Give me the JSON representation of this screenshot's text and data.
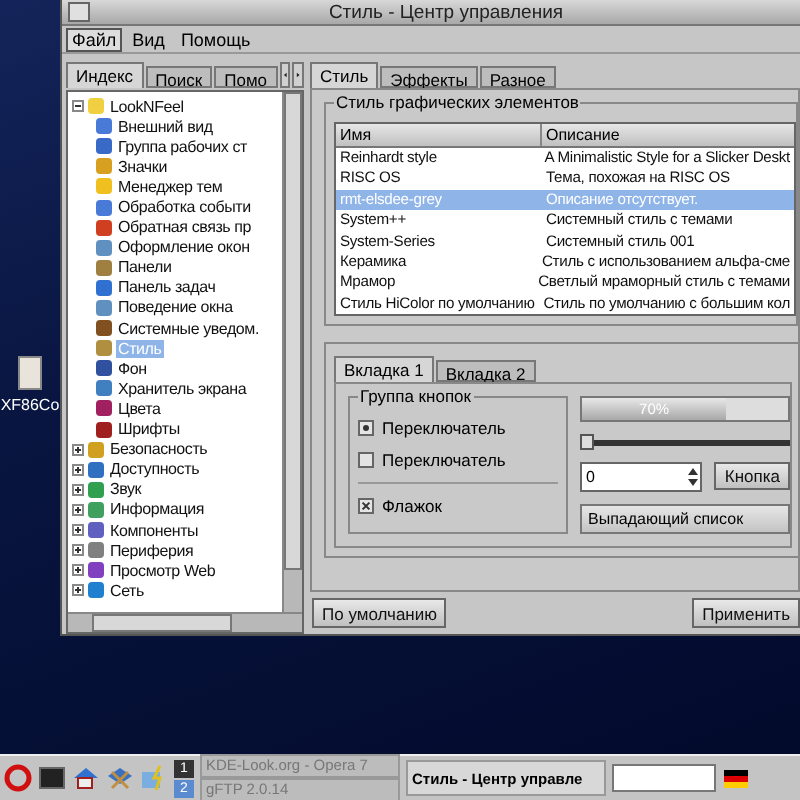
{
  "desktop_icon": {
    "label": "XF86Co"
  },
  "window": {
    "title": "Стиль - Центр управления"
  },
  "menu": [
    {
      "label": "Файл",
      "selected": true
    },
    {
      "label": "Вид",
      "selected": false
    },
    {
      "label": "Помощь",
      "selected": false
    }
  ],
  "left_tabs": [
    {
      "label": "Индекс",
      "selected": true
    },
    {
      "label": "Поиск",
      "selected": false
    },
    {
      "label": "Помо",
      "selected": false
    }
  ],
  "tree": [
    {
      "label": "LookNFeel",
      "expanded": true,
      "selected": false,
      "children": [
        {
          "label": "Внешний вид",
          "selected": false
        },
        {
          "label": "Группа рабочих ст",
          "selected": false
        },
        {
          "label": "Значки",
          "selected": false
        },
        {
          "label": "Менеджер тем",
          "selected": false
        },
        {
          "label": "Обработка событи",
          "selected": false
        },
        {
          "label": "Обратная связь пр",
          "selected": false
        },
        {
          "label": "Оформление окон",
          "selected": false
        },
        {
          "label": "Панели",
          "selected": false
        },
        {
          "label": "Панель задач",
          "selected": false
        },
        {
          "label": "Поведение окна",
          "selected": false
        },
        {
          "label": "Системные уведом.",
          "selected": false
        },
        {
          "label": "Стиль",
          "selected": true
        },
        {
          "label": "Фон",
          "selected": false
        },
        {
          "label": "Хранитель экрана",
          "selected": false
        },
        {
          "label": "Цвета",
          "selected": false
        },
        {
          "label": "Шрифты",
          "selected": false
        }
      ]
    },
    {
      "label": "Безопасность",
      "expanded": false,
      "selected": false
    },
    {
      "label": "Доступность",
      "expanded": false,
      "selected": false
    },
    {
      "label": "Звук",
      "expanded": false,
      "selected": false
    },
    {
      "label": "Информация",
      "expanded": false,
      "selected": false
    },
    {
      "label": "Компоненты",
      "expanded": false,
      "selected": false
    },
    {
      "label": "Периферия",
      "expanded": false,
      "selected": false
    },
    {
      "label": "Просмотр Web",
      "expanded": false,
      "selected": false
    },
    {
      "label": "Сеть",
      "expanded": false,
      "selected": false
    }
  ],
  "right_tabs": [
    {
      "label": "Стиль",
      "selected": true
    },
    {
      "label": "Эффекты",
      "selected": false
    },
    {
      "label": "Разное",
      "selected": false
    }
  ],
  "style_group": {
    "title": "Стиль графических элементов",
    "columns": [
      "Имя",
      "Описание"
    ],
    "rows": [
      {
        "name": "Reinhardt style",
        "description": "A Minimalistic Style for a Slicker Deskt",
        "selected": false
      },
      {
        "name": "RISC OS",
        "description": "Тема, похожая на RISC OS",
        "selected": false
      },
      {
        "name": "rmt-elsdee-grey",
        "description": "Описание отсутствует.",
        "selected": true
      },
      {
        "name": "System++",
        "description": "Системный стиль с темами",
        "selected": false
      },
      {
        "name": "System-Series",
        "description": "Системный стиль 001",
        "selected": false
      },
      {
        "name": "Керамика",
        "description": "Стиль с использованием альфа-сме",
        "selected": false
      },
      {
        "name": "Мрамор",
        "description": "Светлый мраморный стиль с темами",
        "selected": false
      },
      {
        "name": "Стиль HiColor по умолчанию",
        "description": "Стиль по умолчанию с большим кол",
        "selected": false
      }
    ]
  },
  "preview": {
    "tabs": [
      {
        "label": "Вкладка 1",
        "selected": true
      },
      {
        "label": "Вкладка 2",
        "selected": false
      }
    ],
    "button_group": {
      "title": "Группа кнопок",
      "radios": [
        {
          "label": "Переключатель",
          "selected": true
        },
        {
          "label": "Переключатель",
          "selected": false
        }
      ]
    },
    "checkbox": {
      "label": "Флажок",
      "checked": true
    },
    "progress": {
      "level": 0.7,
      "reading": "70%"
    },
    "slider": {
      "level": 0
    },
    "spin": {
      "value": "0"
    },
    "button": "Кнопка",
    "combo": "Выпадающий список"
  },
  "buttons": {
    "defaults": "По умолчанию",
    "apply": "Применить"
  },
  "taskbar": {
    "pager": [
      {
        "label": "1",
        "selected": false
      },
      {
        "label": "2",
        "selected": true
      }
    ],
    "tasks": [
      {
        "label": "KDE-Look.org - Opera 7",
        "active": false
      },
      {
        "label": "gFTP 2.0.14",
        "active": false
      },
      {
        "label": "Стиль - Центр управле",
        "active": true
      }
    ]
  }
}
